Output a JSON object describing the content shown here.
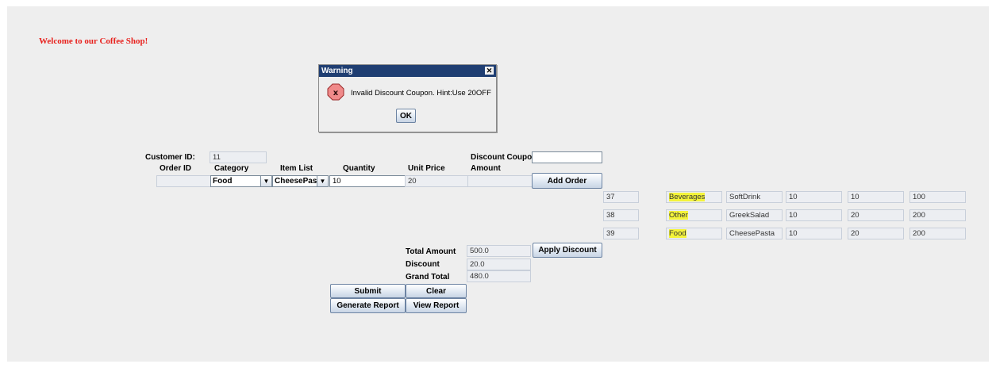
{
  "welcome": "Welcome to our Coffee Shop!",
  "dialog": {
    "title": "Warning",
    "message": "Invalid Discount Coupon. Hint:Use 20OFF",
    "ok": "OK",
    "close": "✕"
  },
  "form": {
    "customer_label": "Customer ID:",
    "customer_id": "11",
    "discount_coupon_label": "Discount Coupon",
    "discount_coupon_value": "",
    "headers": {
      "order_id": "Order ID",
      "category": "Category",
      "item_list": "Item List",
      "quantity": "Quantity",
      "unit_price": "Unit Price",
      "amount": "Amount"
    },
    "order_id": "",
    "category": "Food",
    "item": "CheesePasta",
    "quantity": "10",
    "unit_price": "20",
    "amount": "",
    "add_order": "Add Order"
  },
  "orders": [
    {
      "id": "37",
      "category": "Beverages",
      "item": "SoftDrink",
      "qty": "10",
      "price": "10",
      "amount": "100"
    },
    {
      "id": "38",
      "category": "Other",
      "item": "GreekSalad",
      "qty": "10",
      "price": "20",
      "amount": "200"
    },
    {
      "id": "39",
      "category": "Food",
      "item": "CheesePasta",
      "qty": "10",
      "price": "20",
      "amount": "200"
    }
  ],
  "totals": {
    "total_label": "Total Amount",
    "total": "500.0",
    "apply_discount": "Apply Discount",
    "discount_label": "Discount",
    "discount": "20.0",
    "grand_label": "Grand Total",
    "grand": "480.0"
  },
  "actions": {
    "submit": "Submit",
    "clear": "Clear",
    "report": "Generate Report",
    "view": "View Report"
  },
  "colors": {
    "highlight": "#f4f43a",
    "title_bar": "#1f3e72",
    "welcome": "#e8211d"
  }
}
